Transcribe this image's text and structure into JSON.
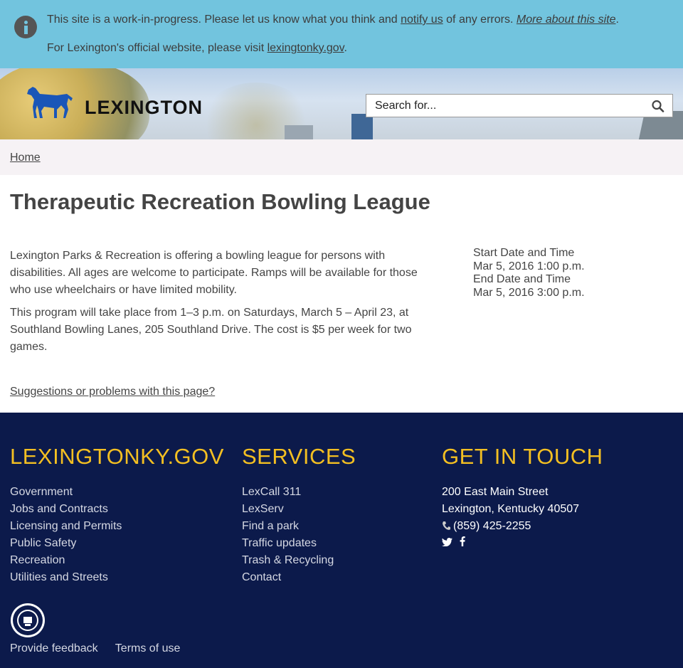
{
  "alert": {
    "line1_part1": "This site is a work-in-progress. Please let us know what you think and ",
    "line1_link": "notify us",
    "line1_part2": " of any errors. ",
    "line1_link2": "More about this site",
    "line1_end": ".",
    "line2_part1": "For Lexington's official website, please visit ",
    "line2_link": "lexingtonky.gov",
    "line2_end": "."
  },
  "header": {
    "logo_text": "LEXINGTON",
    "search_placeholder": "Search for..."
  },
  "breadcrumb": {
    "home": "Home"
  },
  "main": {
    "title": "Therapeutic Recreation Bowling League",
    "paragraphs": [
      "Lexington Parks & Recreation is offering a bowling league for persons with disabilities. All ages are welcome to participate. Ramps will be available for those who use wheelchairs or have limited mobility.",
      "This program will take place from 1–3 p.m. on Saturdays, March 5 – April 23, at Southland Bowling Lanes, 205 Southland Drive. The cost is $5 per week for two games."
    ],
    "start_label": "Start Date and Time",
    "start_value": "Mar 5, 2016 1:00 p.m.",
    "end_label": "End Date and Time",
    "end_value": "Mar 5, 2016 3:00 p.m.",
    "suggestions_link": "Suggestions or problems with this page?"
  },
  "footer": {
    "col1": {
      "heading": "LEXINGTONKY.GOV",
      "links": [
        "Government",
        "Jobs and Contracts",
        "Licensing and Permits",
        "Public Safety",
        "Recreation",
        "Utilities and Streets"
      ]
    },
    "col2": {
      "heading": "SERVICES",
      "links": [
        "LexCall 311",
        "LexServ",
        "Find a park",
        "Traffic updates",
        "Trash & Recycling",
        "Contact"
      ]
    },
    "col3": {
      "heading": "GET IN TOUCH",
      "address1": "200 East Main Street",
      "address2": "Lexington, Kentucky 40507",
      "phone": "(859) 425-2255"
    },
    "bottom_links": [
      "Provide feedback",
      "Terms of use"
    ]
  },
  "colors": {
    "alert_bg": "#72c4de",
    "footer_bg": "#0c1a4b",
    "footer_heading": "#f3bf22",
    "horse_blue": "#1a56b8"
  },
  "icons": [
    "info-icon",
    "horse-logo-icon",
    "search-icon",
    "phone-icon",
    "twitter-icon",
    "facebook-icon",
    "city-seal-icon"
  ]
}
